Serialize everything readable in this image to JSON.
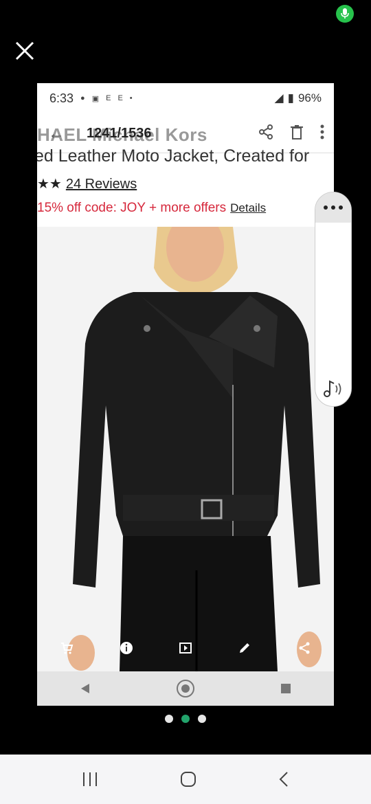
{
  "status": {
    "time": "6:33",
    "battery": "96%",
    "icons": [
      "messenger-icon",
      "calendar-icon",
      "e-icon",
      "e-icon",
      "dot-icon"
    ]
  },
  "gallery": {
    "bg_title": "HAEL Michael Kors",
    "counter": "1241/1536"
  },
  "product": {
    "title": "ed Leather Moto Jacket, Created for",
    "stars": "★★",
    "reviews": "24 Reviews",
    "promo": "15% off code: JOY + more offers",
    "details": "Details"
  },
  "pager": {
    "active_index": 1,
    "count": 3
  },
  "colors": {
    "accent": "#22a36b",
    "promo": "#d6283c",
    "mic": "#27c24c"
  }
}
